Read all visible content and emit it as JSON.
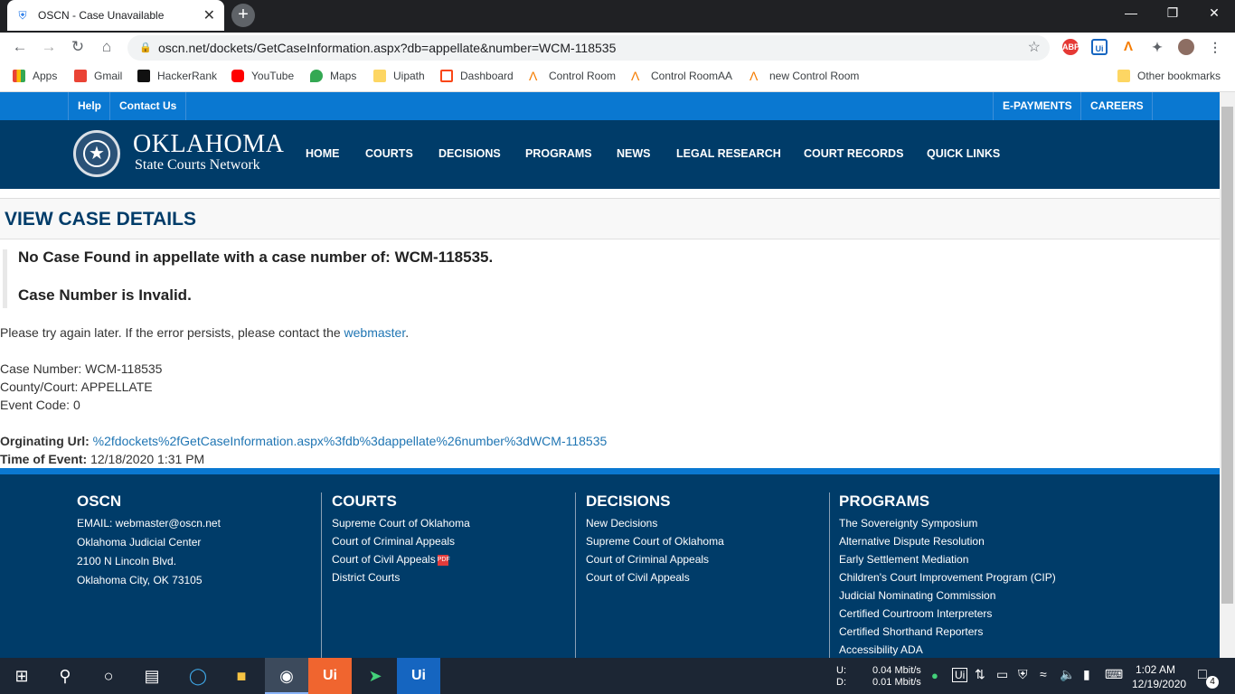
{
  "browser": {
    "tab_title": "OSCN - Case Unavailable",
    "url": "oscn.net/dockets/GetCaseInformation.aspx?db=appellate&number=WCM-118535",
    "bookmarks": [
      "Apps",
      "Gmail",
      "HackerRank",
      "YouTube",
      "Maps",
      "Uipath",
      "Dashboard",
      "Control Room",
      "Control RoomAA",
      "new Control Room"
    ],
    "other_bookmarks": "Other bookmarks",
    "ext_abp": "ABP",
    "ext_ui": "Ui"
  },
  "site": {
    "util_links": {
      "help": "Help",
      "contact": "Contact Us",
      "epayments": "E-PAYMENTS",
      "careers": "CAREERS"
    },
    "brand": {
      "line1": "OKLAHOMA",
      "line2": "State Courts Network"
    },
    "nav": [
      "HOME",
      "COURTS",
      "DECISIONS",
      "PROGRAMS",
      "NEWS",
      "LEGAL RESEARCH",
      "COURT RECORDS",
      "QUICK LINKS"
    ]
  },
  "content": {
    "page_title": "VIEW CASE DETAILS",
    "alert_line1": "No Case Found in appellate with a case number of: WCM-118535.",
    "alert_line2": "Case Number is Invalid.",
    "message_pre": "Please try again later. If the error persists, please contact the ",
    "message_link": "webmaster",
    "message_post": ".",
    "case_number": "Case Number: WCM-118535",
    "county_court": "County/Court: APPELLATE",
    "event_code": "Event Code: 0",
    "orig_label": "Orginating Url:",
    "orig_value": "%2fdockets%2fGetCaseInformation.aspx%3fdb%3dappellate%26number%3dWCM-118535",
    "time_label": "Time of Event:",
    "time_value": "12/18/2020 1:31 PM"
  },
  "footer": {
    "oscn": {
      "title": "OSCN",
      "lines": [
        "EMAIL: webmaster@oscn.net",
        "Oklahoma Judicial Center",
        "2100 N Lincoln Blvd.",
        "Oklahoma City, OK 73105"
      ]
    },
    "courts": {
      "title": "COURTS",
      "links": [
        "Supreme Court of Oklahoma",
        "Court of Criminal Appeals",
        "Court of Civil Appeals",
        "District Courts"
      ]
    },
    "decisions": {
      "title": "DECISIONS",
      "links": [
        "New Decisions",
        "Supreme Court of Oklahoma",
        "Court of Criminal Appeals",
        "Court of Civil Appeals"
      ]
    },
    "programs": {
      "title": "PROGRAMS",
      "links": [
        "The Sovereignty Symposium",
        "Alternative Dispute Resolution",
        "Early Settlement Mediation",
        "Children's Court Improvement Program (CIP)",
        "Judicial Nominating Commission",
        "Certified Courtroom Interpreters",
        "Certified Shorthand Reporters",
        "Accessibility ADA"
      ]
    }
  },
  "taskbar": {
    "upload_label": "U:",
    "download_label": "D:",
    "upload_speed": "0.04 Mbit/s",
    "download_speed": "0.01 Mbit/s",
    "time": "1:02 AM",
    "date": "12/19/2020",
    "notifications": "4",
    "ui_label": "Ui"
  }
}
